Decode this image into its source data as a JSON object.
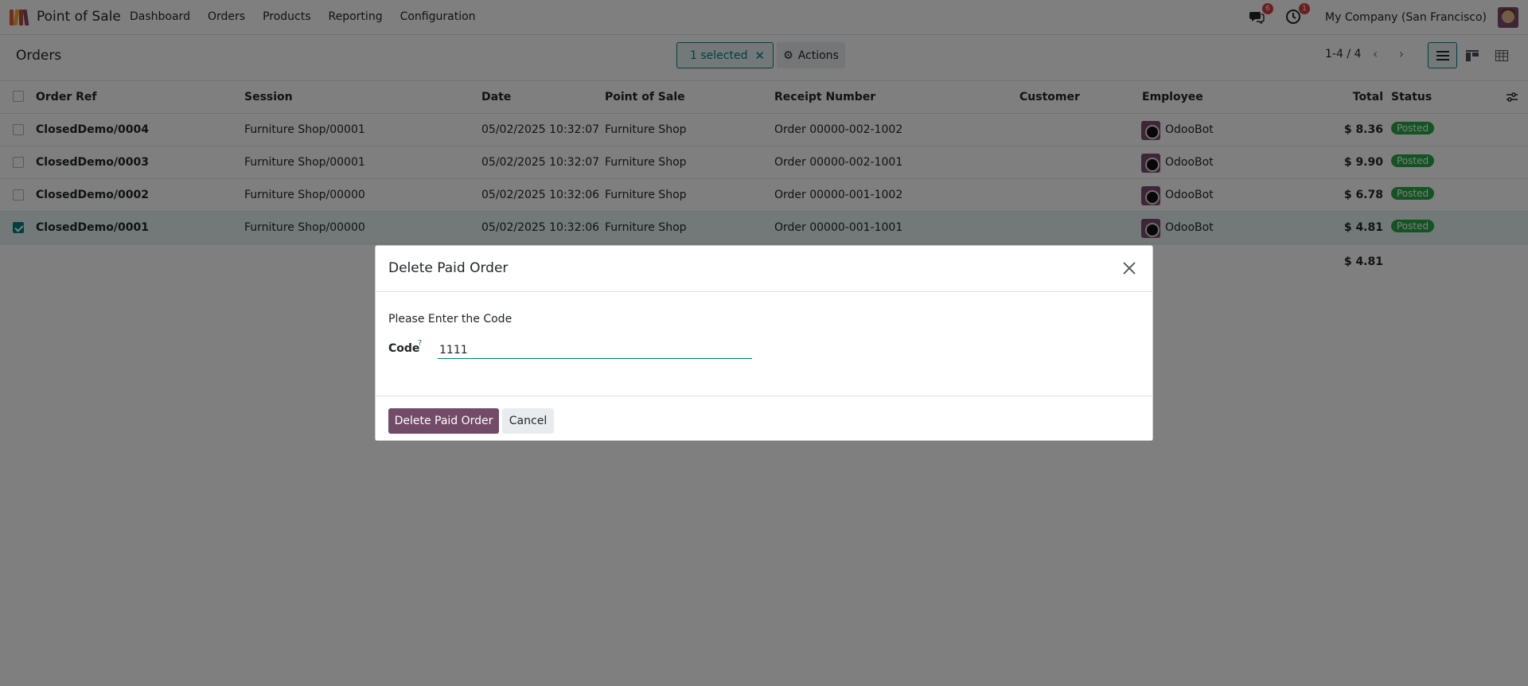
{
  "navbar": {
    "app_name": "Point of Sale",
    "menu": [
      "Dashboard",
      "Orders",
      "Products",
      "Reporting",
      "Configuration"
    ],
    "messages_count": "6",
    "activities_count": "1",
    "company": "My Company (San Francisco)"
  },
  "control": {
    "breadcrumb": "Orders",
    "selected_label": "1 selected",
    "actions_label": "Actions",
    "pager": "1-4 / 4"
  },
  "table": {
    "columns": {
      "order_ref": "Order Ref",
      "session": "Session",
      "date": "Date",
      "point_of_sale": "Point of Sale",
      "receipt_number": "Receipt Number",
      "customer": "Customer",
      "employee": "Employee",
      "total": "Total",
      "status": "Status"
    },
    "rows": [
      {
        "ref": "ClosedDemo/0004",
        "session": "Furniture Shop/00001",
        "date": "05/02/2025 10:32:07",
        "pos": "Furniture Shop",
        "receipt": "Order 00000-002-1002",
        "customer": "",
        "employee": "OdooBot",
        "total": "$ 8.36",
        "status": "Posted"
      },
      {
        "ref": "ClosedDemo/0003",
        "session": "Furniture Shop/00001",
        "date": "05/02/2025 10:32:07",
        "pos": "Furniture Shop",
        "receipt": "Order 00000-002-1001",
        "customer": "",
        "employee": "OdooBot",
        "total": "$ 9.90",
        "status": "Posted"
      },
      {
        "ref": "ClosedDemo/0002",
        "session": "Furniture Shop/00000",
        "date": "05/02/2025 10:32:06",
        "pos": "Furniture Shop",
        "receipt": "Order 00000-001-1002",
        "customer": "",
        "employee": "OdooBot",
        "total": "$ 6.78",
        "status": "Posted"
      },
      {
        "ref": "ClosedDemo/0001",
        "session": "Furniture Shop/00000",
        "date": "05/02/2025 10:32:06",
        "pos": "Furniture Shop",
        "receipt": "Order 00000-001-1001",
        "customer": "",
        "employee": "OdooBot",
        "total": "$ 4.81",
        "status": "Posted"
      }
    ],
    "sum_total": "$ 4.81"
  },
  "dialog": {
    "title": "Delete Paid Order",
    "prompt": "Please Enter the Code",
    "code_label": "Code",
    "help_mark": "?",
    "code_value": "1111",
    "confirm_label": "Delete Paid Order",
    "cancel_label": "Cancel"
  },
  "colors": {
    "brand": "#714b67",
    "accent": "#017e84",
    "success": "#28a745",
    "badge": "#d23f3a"
  }
}
